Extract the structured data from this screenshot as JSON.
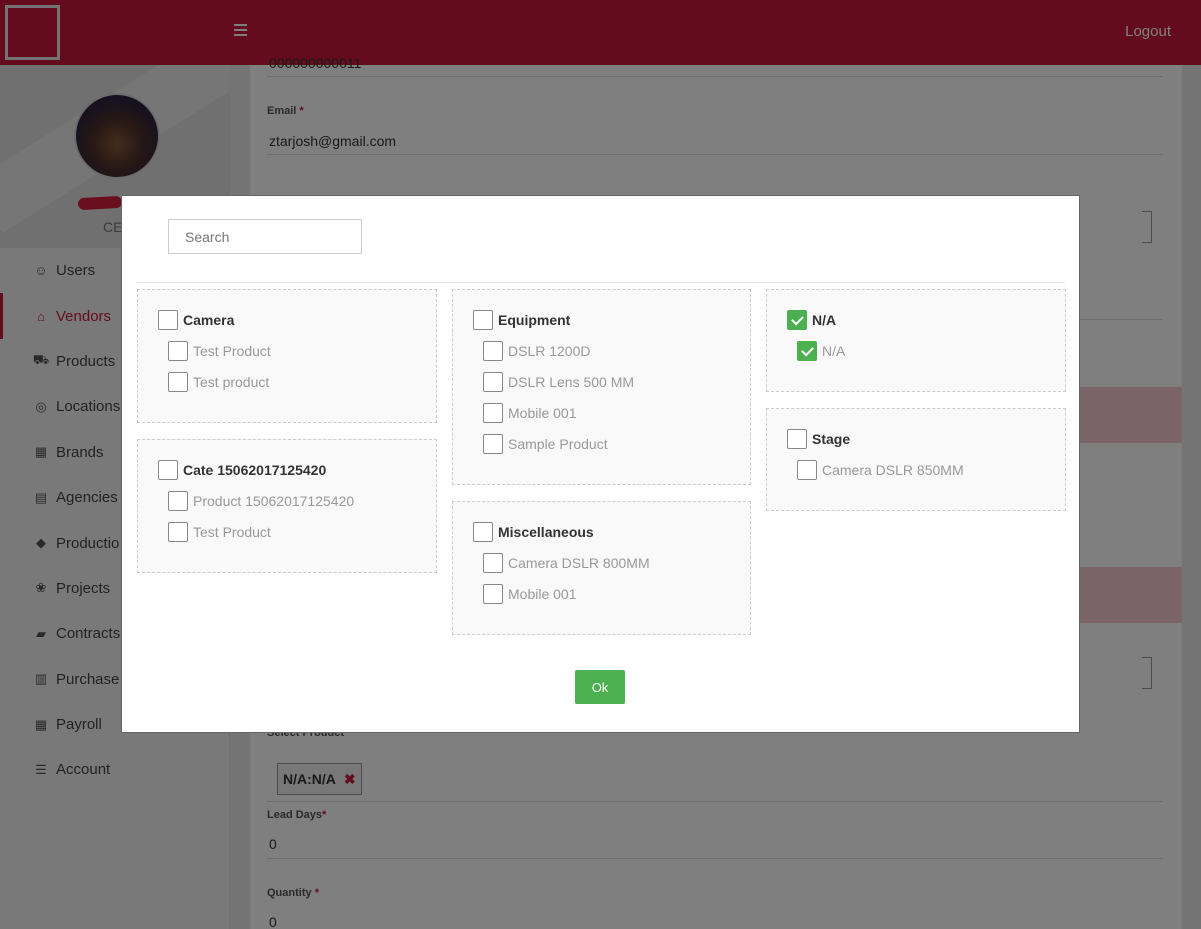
{
  "header": {
    "logout_label": "Logout"
  },
  "sidebar": {
    "role": "CE",
    "items": [
      {
        "label": "Users",
        "icon": "user-icon",
        "glyph": "☺",
        "active": false
      },
      {
        "label": "Vendors",
        "icon": "bank-icon",
        "glyph": "⌂",
        "active": true
      },
      {
        "label": "Products",
        "icon": "cart-icon",
        "glyph": "⛟",
        "active": false
      },
      {
        "label": "Locations",
        "icon": "map-pin-icon",
        "glyph": "◎",
        "active": false
      },
      {
        "label": "Brands",
        "icon": "building-icon",
        "glyph": "▦",
        "active": false
      },
      {
        "label": "Agencies",
        "icon": "card-icon",
        "glyph": "▤",
        "active": false
      },
      {
        "label": "Productio",
        "icon": "shield-icon",
        "glyph": "◆",
        "active": false
      },
      {
        "label": "Projects",
        "icon": "award-icon",
        "glyph": "❀",
        "active": false
      },
      {
        "label": "Contracts",
        "icon": "folder-icon",
        "glyph": "▰",
        "active": false
      },
      {
        "label": "Purchase",
        "icon": "receipt-icon",
        "glyph": "▥",
        "active": false
      },
      {
        "label": "Payroll",
        "icon": "table-icon",
        "glyph": "▦",
        "active": false
      },
      {
        "label": "Account",
        "icon": "list-icon",
        "glyph": "☰",
        "active": false
      }
    ]
  },
  "form": {
    "phone_value": "000000000011",
    "email_label": "Email",
    "email_value": "ztarjosh@gmail.com",
    "select_product_label": "Select Product",
    "selected_product_chip": "N/A:N/A",
    "lead_days_label": "Lead Days",
    "lead_days_value": "0",
    "quantity_label": "Quantity",
    "quantity_value": "0"
  },
  "modal": {
    "search_placeholder": "Search",
    "ok_label": "Ok",
    "groups": [
      {
        "category": "Camera",
        "checked": false,
        "items": [
          {
            "label": "Test Product",
            "checked": false
          },
          {
            "label": "Test product",
            "checked": false
          }
        ]
      },
      {
        "category": "Cate 15062017125420",
        "checked": false,
        "items": [
          {
            "label": "Product 15062017125420",
            "checked": false
          },
          {
            "label": "Test Product",
            "checked": false
          }
        ]
      },
      {
        "category": "Equipment",
        "checked": false,
        "items": [
          {
            "label": "DSLR 1200D",
            "checked": false
          },
          {
            "label": "DSLR Lens 500 MM",
            "checked": false
          },
          {
            "label": "Mobile 001",
            "checked": false
          },
          {
            "label": "Sample Product",
            "checked": false
          }
        ]
      },
      {
        "category": "Miscellaneous",
        "checked": false,
        "items": [
          {
            "label": "Camera DSLR 800MM",
            "checked": false
          },
          {
            "label": "Mobile 001",
            "checked": false
          }
        ]
      },
      {
        "category": "N/A",
        "checked": true,
        "items": [
          {
            "label": "N/A",
            "checked": true
          }
        ]
      },
      {
        "category": "Stage",
        "checked": false,
        "items": [
          {
            "label": "Camera DSLR 850MM",
            "checked": false
          }
        ]
      }
    ]
  },
  "colors": {
    "brand": "#c8193a",
    "ok_green": "#4caf50"
  }
}
